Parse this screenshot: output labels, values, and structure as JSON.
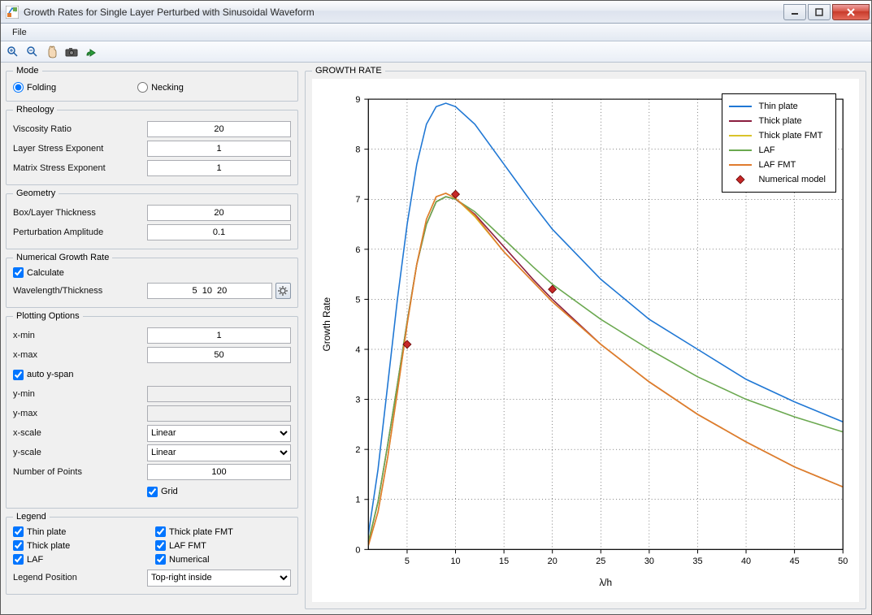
{
  "window": {
    "title": "Growth Rates for Single Layer Perturbed with Sinusoidal Waveform"
  },
  "menu": {
    "file": "File"
  },
  "toolbar_icons": [
    "zoom-in",
    "zoom-out",
    "pan",
    "camera",
    "export"
  ],
  "mode": {
    "legend": "Mode",
    "folding": "Folding",
    "necking": "Necking",
    "selected": "folding"
  },
  "rheology": {
    "legend": "Rheology",
    "viscosity_ratio_lbl": "Viscosity Ratio",
    "viscosity_ratio": "20",
    "layer_exp_lbl": "Layer Stress Exponent",
    "layer_exp": "1",
    "matrix_exp_lbl": "Matrix Stress Exponent",
    "matrix_exp": "1"
  },
  "geometry": {
    "legend": "Geometry",
    "box_lbl": "Box/Layer Thickness",
    "box": "20",
    "pert_lbl": "Perturbation Amplitude",
    "pert": "0.1"
  },
  "numerical": {
    "legend": "Numerical Growth Rate",
    "calc_lbl": "Calculate",
    "calc": true,
    "wl_lbl": "Wavelength/Thickness",
    "wl": "5  10  20"
  },
  "plotting": {
    "legend": "Plotting Options",
    "xmin_lbl": "x-min",
    "xmin": "1",
    "xmax_lbl": "x-max",
    "xmax": "50",
    "auto_lbl": "auto y-span",
    "auto": true,
    "ymin_lbl": "y-min",
    "ymin": "",
    "ymax_lbl": "y-max",
    "ymax": "",
    "xscale_lbl": "x-scale",
    "xscale": "Linear",
    "yscale_lbl": "y-scale",
    "yscale": "Linear",
    "npts_lbl": "Number of Points",
    "npts": "100",
    "grid_lbl": "Grid",
    "grid": true
  },
  "legendbox": {
    "legend": "Legend",
    "items": [
      {
        "label": "Thin plate",
        "checked": true
      },
      {
        "label": "Thick plate",
        "checked": true
      },
      {
        "label": "LAF",
        "checked": true
      },
      {
        "label": "Thick plate FMT",
        "checked": true
      },
      {
        "label": "LAF FMT",
        "checked": true
      },
      {
        "label": "Numerical",
        "checked": true
      }
    ],
    "pos_lbl": "Legend Position",
    "pos": "Top-right inside"
  },
  "chart_panel_title": "GROWTH RATE",
  "chart_data": {
    "type": "line",
    "xlabel": "λ/h",
    "ylabel": "Growth Rate",
    "xlim": [
      1,
      50
    ],
    "ylim": [
      0,
      9
    ],
    "xticks": [
      5,
      10,
      15,
      20,
      25,
      30,
      35,
      40,
      45,
      50
    ],
    "yticks": [
      0,
      1,
      2,
      3,
      4,
      5,
      6,
      7,
      8,
      9
    ],
    "grid": true,
    "legend_position": "top-right-inside",
    "series": [
      {
        "name": "Thin plate",
        "color": "#1f77d4",
        "x": [
          1,
          2,
          3,
          4,
          5,
          6,
          7,
          8,
          9,
          10,
          12,
          15,
          18,
          20,
          25,
          30,
          35,
          40,
          45,
          50
        ],
        "y": [
          0.3,
          1.6,
          3.3,
          5.0,
          6.5,
          7.7,
          8.5,
          8.85,
          8.92,
          8.85,
          8.5,
          7.7,
          6.9,
          6.4,
          5.4,
          4.6,
          4.0,
          3.4,
          2.95,
          2.55
        ]
      },
      {
        "name": "Thick plate",
        "color": "#8b1e3f",
        "x": [
          1,
          2,
          3,
          4,
          5,
          6,
          7,
          8,
          9,
          10,
          12,
          15,
          18,
          20,
          25,
          30,
          35,
          40,
          45,
          50
        ],
        "y": [
          0.15,
          0.95,
          2.1,
          3.3,
          4.55,
          5.7,
          6.5,
          6.95,
          7.05,
          7.0,
          6.7,
          6.05,
          5.4,
          5.0,
          4.1,
          3.35,
          2.7,
          2.15,
          1.65,
          1.25
        ]
      },
      {
        "name": "Thick plate FMT",
        "color": "#d9c32a",
        "x": [
          1,
          2,
          3,
          4,
          5,
          6,
          7,
          8,
          9,
          10,
          12,
          15,
          18,
          20,
          25,
          30,
          35,
          40,
          45,
          50
        ],
        "y": [
          0.08,
          0.75,
          1.85,
          3.15,
          4.5,
          5.7,
          6.6,
          7.05,
          7.12,
          7.02,
          6.65,
          5.95,
          5.35,
          4.95,
          4.1,
          3.35,
          2.7,
          2.15,
          1.65,
          1.25
        ]
      },
      {
        "name": "LAF",
        "color": "#6aa84f",
        "x": [
          1,
          2,
          3,
          4,
          5,
          6,
          7,
          8,
          9,
          10,
          12,
          15,
          18,
          20,
          25,
          30,
          35,
          40,
          45,
          50
        ],
        "y": [
          0.15,
          0.95,
          2.1,
          3.3,
          4.55,
          5.7,
          6.5,
          6.95,
          7.05,
          7.0,
          6.75,
          6.2,
          5.65,
          5.3,
          4.6,
          4.0,
          3.45,
          3.0,
          2.65,
          2.35
        ]
      },
      {
        "name": "LAF FMT",
        "color": "#e07b2e",
        "x": [
          1,
          2,
          3,
          4,
          5,
          6,
          7,
          8,
          9,
          10,
          12,
          15,
          18,
          20,
          25,
          30,
          35,
          40,
          45,
          50
        ],
        "y": [
          0.08,
          0.75,
          1.85,
          3.15,
          4.5,
          5.7,
          6.6,
          7.05,
          7.12,
          7.02,
          6.68,
          5.95,
          5.35,
          4.95,
          4.1,
          3.35,
          2.7,
          2.15,
          1.65,
          1.25
        ]
      }
    ],
    "markers": {
      "name": "Numerical model",
      "shape": "diamond",
      "color": "#c62828",
      "points": [
        {
          "x": 5,
          "y": 4.1
        },
        {
          "x": 10,
          "y": 7.1
        },
        {
          "x": 20,
          "y": 5.2
        }
      ]
    }
  }
}
